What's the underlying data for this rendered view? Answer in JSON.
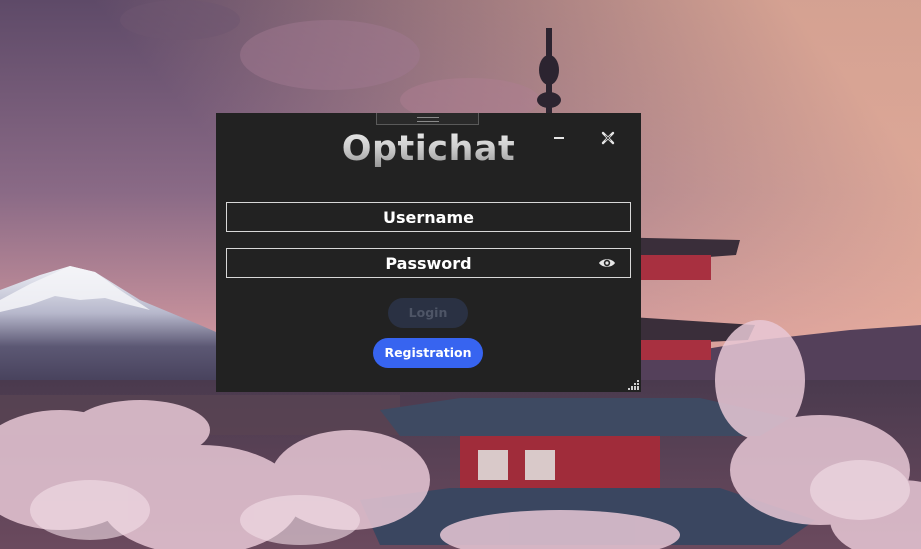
{
  "window": {
    "title": "Optichat",
    "minimize_icon": "minimize-icon",
    "close_icon": "close-icon"
  },
  "form": {
    "username_placeholder": "Username",
    "username_value": "",
    "password_placeholder": "Password",
    "password_value": "",
    "toggle_password_icon": "eye-icon",
    "login_label": "Login",
    "registration_label": "Registration"
  },
  "colors": {
    "dialog_bg": "#222222",
    "accent": "#3764f0",
    "disabled_button": "#2a3143",
    "field_border": "#d8d8d8"
  }
}
